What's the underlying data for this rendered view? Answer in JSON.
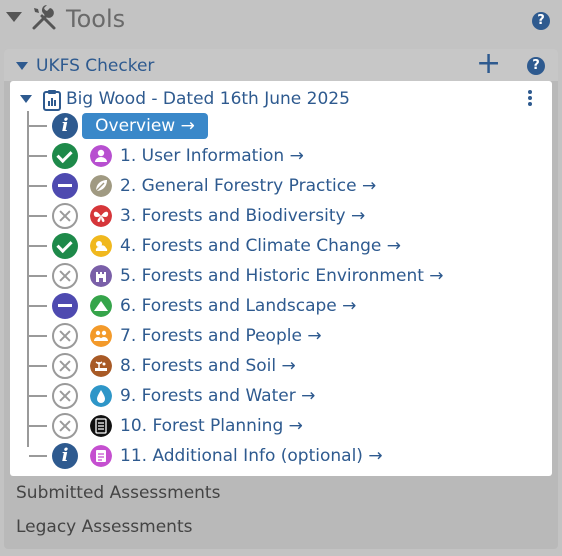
{
  "tools": {
    "title": "Tools",
    "help_label": "?"
  },
  "checker": {
    "title": "UKFS Checker",
    "help_label": "?",
    "add_label": "+"
  },
  "assessment": {
    "title": "Big Wood - Dated 16th June 2025",
    "overview_label": "Overview →",
    "items": [
      {
        "label": "1. User Information →",
        "status": "check",
        "icon": "user-icon",
        "color": "#b74fd0"
      },
      {
        "label": "2. General Forestry Practice →",
        "status": "partial",
        "icon": "leaf-icon",
        "color": "#a09a82"
      },
      {
        "label": "3. Forests and Biodiversity →",
        "status": "none",
        "icon": "butterfly-icon",
        "color": "#d6363a"
      },
      {
        "label": "4. Forests and Climate Change →",
        "status": "check",
        "icon": "sun-cloud-icon",
        "color": "#f0b81e"
      },
      {
        "label": "5. Forests and Historic Environment →",
        "status": "none",
        "icon": "castle-icon",
        "color": "#7a5fa8"
      },
      {
        "label": "6. Forests and Landscape →",
        "status": "partial",
        "icon": "mountain-icon",
        "color": "#35a44a"
      },
      {
        "label": "7. Forests and People →",
        "status": "none",
        "icon": "people-icon",
        "color": "#f39a2a"
      },
      {
        "label": "8. Forests and Soil →",
        "status": "none",
        "icon": "soil-icon",
        "color": "#a85a26"
      },
      {
        "label": "9. Forests and Water →",
        "status": "none",
        "icon": "water-drop-icon",
        "color": "#2e96c8"
      },
      {
        "label": "10. Forest Planning →",
        "status": "none",
        "icon": "checklist-icon",
        "color": "#111111"
      },
      {
        "label": "11. Additional Info (optional) →",
        "status": "info",
        "icon": "document-icon",
        "color": "#c54fd0"
      }
    ]
  },
  "footer": {
    "submitted": "Submitted Assessments",
    "legacy": "Legacy Assessments"
  },
  "colors": {
    "accent": "#2e5a8f",
    "button": "#3a88c9",
    "complete": "#1e8a4a",
    "partial": "#4e4ab0"
  }
}
